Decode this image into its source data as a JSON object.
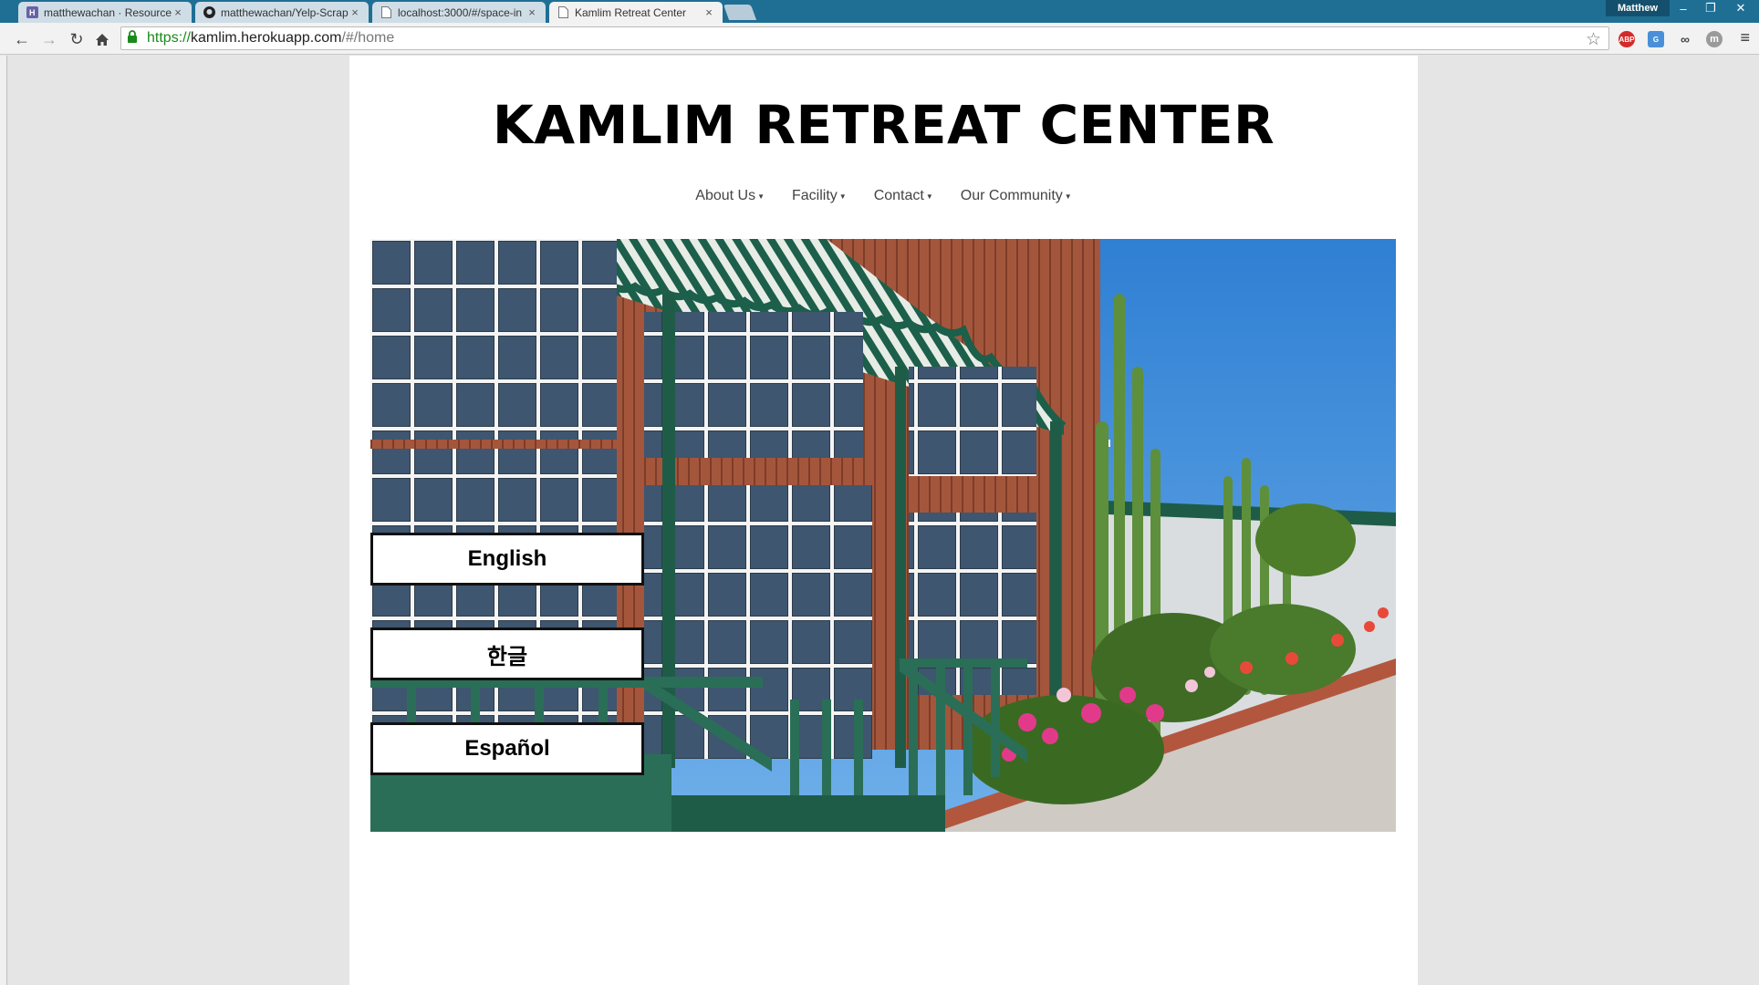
{
  "browser": {
    "tabs": [
      {
        "title": "matthewachan · Resources",
        "icon": "heroku-icon"
      },
      {
        "title": "matthewachan/Yelp-Scrap",
        "icon": "github-icon"
      },
      {
        "title": "localhost:3000/#/space-in",
        "icon": "page-icon"
      },
      {
        "title": "Kamlim Retreat Center",
        "icon": "page-icon",
        "active": true
      }
    ],
    "profile_name": "Matthew",
    "url": {
      "scheme": "https://",
      "host": "kamlim.herokuapp.com",
      "path": "/#/home"
    },
    "extensions": [
      "adblock-plus-icon",
      "translate-icon",
      "glasses-icon",
      "m-icon"
    ]
  },
  "site": {
    "title": "KAMLIM RETREAT CENTER",
    "nav": [
      {
        "label": "About Us"
      },
      {
        "label": "Facility"
      },
      {
        "label": "Contact"
      },
      {
        "label": "Our Community"
      }
    ],
    "languages": [
      {
        "label": "English"
      },
      {
        "label": "한글"
      },
      {
        "label": "Español"
      }
    ]
  },
  "colors": {
    "titlebar": "#1f6f95",
    "awning_green": "#1c5f4a",
    "sky": "#3a86d6",
    "url_green": "#1a8a1a"
  }
}
